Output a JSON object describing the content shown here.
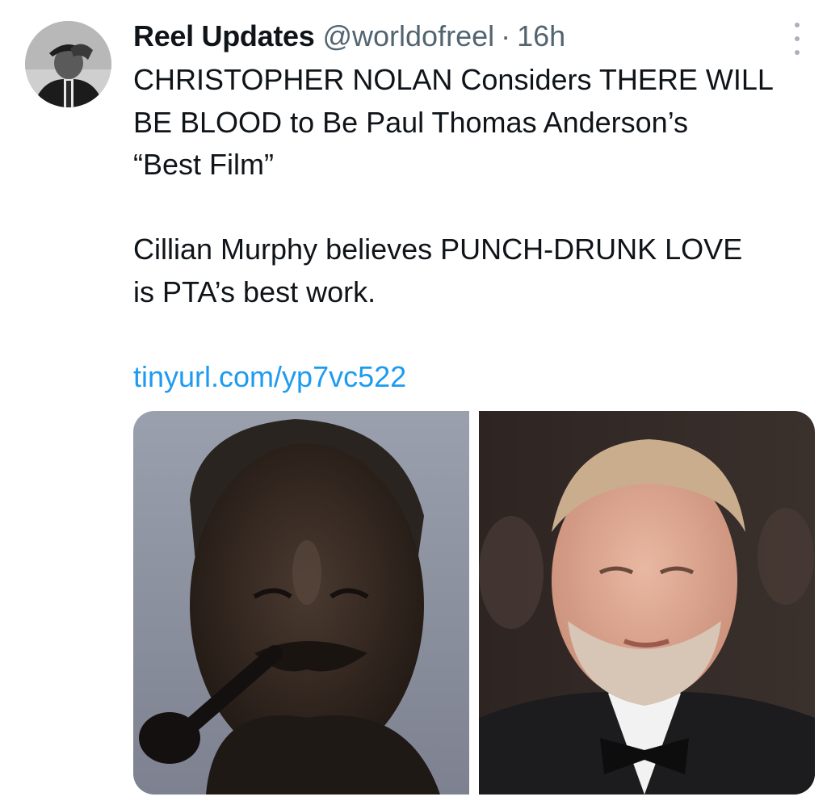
{
  "author": {
    "display_name": "Reel Updates",
    "handle": "@worldofreel",
    "separator": "·",
    "timestamp": "16h"
  },
  "tweet": {
    "lines": [
      "CHRISTOPHER NOLAN Considers THERE WILL",
      "BE BLOOD to Be Paul Thomas Anderson’s",
      "“Best Film”"
    ],
    "lines2": [
      "Cillian Murphy believes PUNCH-DRUNK LOVE",
      "is PTA’s best work."
    ],
    "link": "tinyurl.com/yp7vc522"
  },
  "media": [
    {
      "icon": "photo-man-with-pipe"
    },
    {
      "icon": "photo-man-in-tuxedo"
    }
  ],
  "colors": {
    "link": "#1d9bf0",
    "secondary_text": "#536471",
    "primary_text": "#0f1419"
  }
}
